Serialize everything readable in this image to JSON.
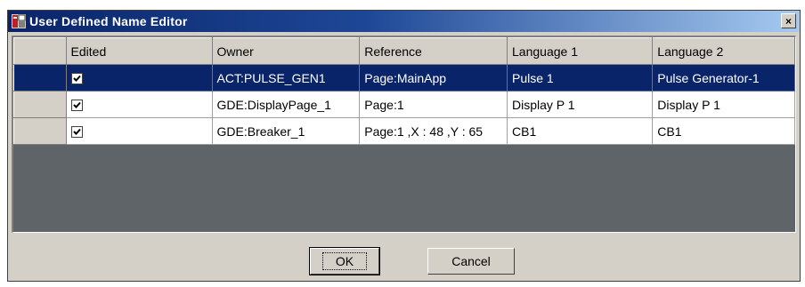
{
  "window": {
    "title": "User Defined Name Editor",
    "close_label": "×"
  },
  "grid": {
    "columns": [
      "Edited",
      "Owner",
      "Reference",
      "Language 1",
      "Language 2"
    ],
    "rows": [
      {
        "edited": true,
        "owner": "ACT:PULSE_GEN1",
        "reference": "Page:MainApp",
        "language1": "Pulse 1",
        "language2": "Pulse Generator-1",
        "selected": true
      },
      {
        "edited": true,
        "owner": "GDE:DisplayPage_1",
        "reference": "Page:1",
        "language1": "Display P 1",
        "language2": "Display P 1",
        "selected": false
      },
      {
        "edited": true,
        "owner": "GDE:Breaker_1",
        "reference": "Page:1 ,X : 48 ,Y : 65",
        "language1": "CB1",
        "language2": "CB1",
        "selected": false
      }
    ]
  },
  "buttons": {
    "ok_label": "OK",
    "cancel_label": "Cancel"
  },
  "colors": {
    "selection": "#0a246a",
    "titlebar_start": "#0a246a",
    "titlebar_end": "#a6caf0",
    "grid_background": "#5f6468",
    "dialog_face": "#d4d0c8"
  },
  "icons": {
    "app": "app-icon",
    "close": "close-icon",
    "checkbox": "checkbox-checked-icon"
  }
}
